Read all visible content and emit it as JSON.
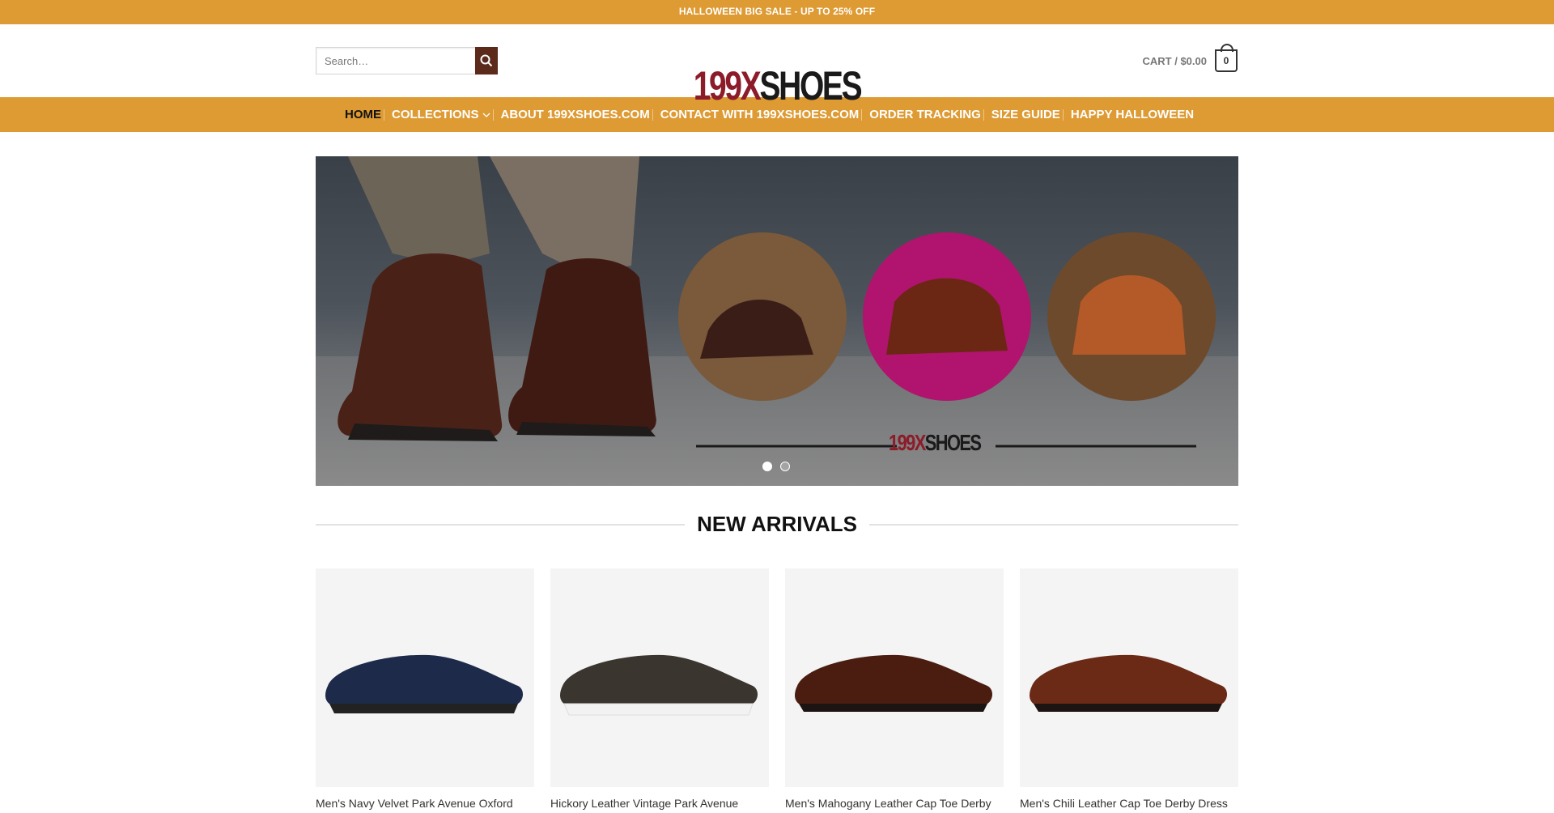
{
  "announcement": "HALLOWEEN BIG SALE - UP TO 25% OFF",
  "search": {
    "placeholder": "Search…"
  },
  "logo": {
    "part1": "199X",
    "part2": "SHOES"
  },
  "cart": {
    "label": "CART / $0.00",
    "count": "0"
  },
  "nav": {
    "items": [
      {
        "label": "HOME",
        "active": true
      },
      {
        "label": "COLLECTIONS",
        "dropdown": true
      },
      {
        "label": "ABOUT 199XSHOES.COM"
      },
      {
        "label": "CONTACT WITH 199XSHOES.COM"
      },
      {
        "label": "ORDER TRACKING"
      },
      {
        "label": "SIZE GUIDE"
      },
      {
        "label": "HAPPY HALLOWEEN"
      }
    ]
  },
  "hero": {
    "logo_part1": "199X",
    "logo_part2": "SHOES",
    "slides": 2,
    "current_slide": 1
  },
  "section": {
    "title": "NEW ARRIVALS"
  },
  "products": [
    {
      "name": "Men's Navy Velvet Park Avenue Oxford",
      "color": "#1d2a4a"
    },
    {
      "name": "Hickory Leather Vintage Park Avenue",
      "color": "#3a352e"
    },
    {
      "name": "Men's Mahogany Leather Cap Toe Derby",
      "color": "#4a1d10"
    },
    {
      "name": "Men's Chili Leather Cap Toe Derby Dress",
      "color": "#6a2a16"
    }
  ],
  "colors": {
    "accent": "#de9a33",
    "search_button": "#5b2a1a",
    "logo_red": "#8c1c2a"
  }
}
